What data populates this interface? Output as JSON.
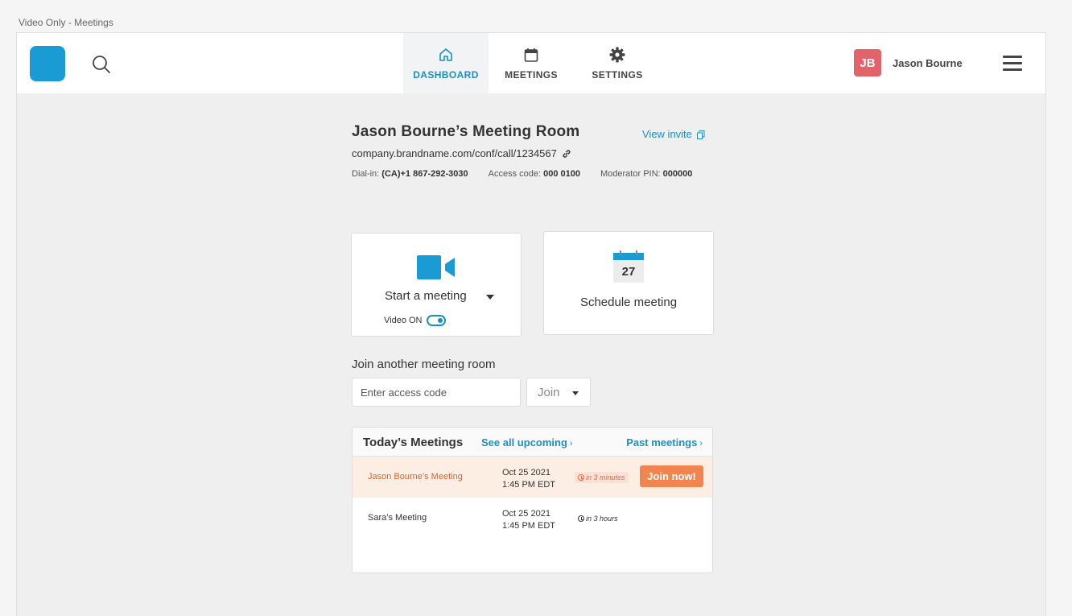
{
  "window": {
    "title": "Video Only - Meetings"
  },
  "nav": {
    "items": [
      {
        "label": "DASHBOARD",
        "icon": "home-icon",
        "active": true
      },
      {
        "label": "MEETINGS",
        "icon": "calendar-icon",
        "active": false
      },
      {
        "label": "SETTINGS",
        "icon": "gear-icon",
        "active": false
      }
    ]
  },
  "user": {
    "initials": "JB",
    "name": "Jason Bourne",
    "avatar_color": "#e2636a"
  },
  "room": {
    "title": "Jason Bourne’s Meeting Room",
    "url": "company.brandname.com/conf/call/1234567",
    "view_invite": "View invite",
    "dialin_label": "Dial-in:",
    "dialin_value": "(CA)+1 867-292-3030",
    "access_label": "Access code:",
    "access_value": "000 0100",
    "pin_label": "Moderator PIN:",
    "pin_value": "000000"
  },
  "start": {
    "label": "Start a meeting",
    "video_label": "Video ON",
    "video_on": true
  },
  "schedule": {
    "label": "Schedule meeting",
    "calendar_day": "27"
  },
  "join": {
    "heading": "Join another meeting room",
    "placeholder": "Enter access code",
    "button": "Join"
  },
  "todays": {
    "title": "Today’s Meetings",
    "see_all": "See all upcoming",
    "past": "Past meetings",
    "rows": [
      {
        "name": "Jason Bourne’s Meeting",
        "date": "Oct 25 2021",
        "time": "1:45 PM EDT",
        "eta": "in 3 minutes",
        "action": "Join now!"
      },
      {
        "name": "Sara’s Meeting",
        "date": "Oct 25 2021",
        "time": "1:45 PM EDT",
        "eta": "in 3 hours"
      }
    ]
  },
  "colors": {
    "accent": "#1a8fc4",
    "brand": "#1a9bd4",
    "alert": "#f2844f"
  }
}
